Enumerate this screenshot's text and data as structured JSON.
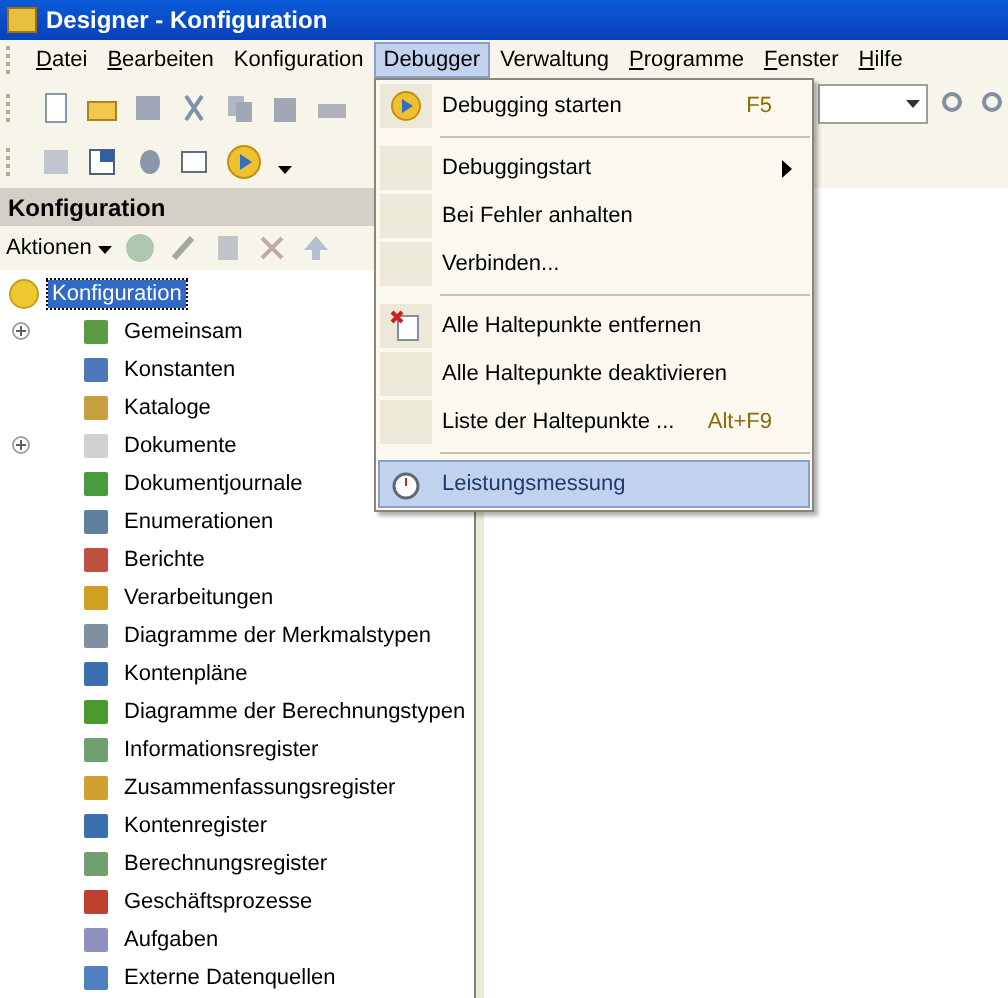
{
  "window": {
    "title": "Designer - Konfiguration"
  },
  "menu_bar": [
    {
      "label": "Datei",
      "mnemonic": true,
      "selected": false
    },
    {
      "label": "Bearbeiten",
      "mnemonic": true,
      "selected": false
    },
    {
      "label": "Konfiguration",
      "mnemonic": false,
      "selected": false
    },
    {
      "label": "Debugger",
      "mnemonic": false,
      "selected": true
    },
    {
      "label": "Verwaltung",
      "mnemonic": false,
      "selected": false
    },
    {
      "label": "Programme",
      "mnemonic": true,
      "selected": false
    },
    {
      "label": "Fenster",
      "mnemonic": true,
      "selected": false
    },
    {
      "label": "Hilfe",
      "mnemonic": true,
      "selected": false
    }
  ],
  "debugger_menu": [
    {
      "kind": "item",
      "label": "Debugging starten",
      "shortcut": "F5",
      "submenu": false,
      "selected": false
    },
    {
      "kind": "separator"
    },
    {
      "kind": "item",
      "label": "Debuggingstart",
      "submenu": true,
      "selected": false
    },
    {
      "kind": "item",
      "label": "Bei Fehler anhalten",
      "submenu": false,
      "selected": false
    },
    {
      "kind": "item",
      "label": "Verbinden...",
      "submenu": false,
      "selected": false
    },
    {
      "kind": "separator"
    },
    {
      "kind": "item",
      "label": "Alle Haltepunkte entfernen",
      "submenu": false,
      "selected": false
    },
    {
      "kind": "item",
      "label": "Alle Haltepunkte deaktivieren",
      "submenu": false,
      "selected": false
    },
    {
      "kind": "item",
      "label": "Liste der Haltepunkte ...",
      "shortcut": "Alt+F9",
      "submenu": false,
      "selected": false
    },
    {
      "kind": "separator"
    },
    {
      "kind": "item",
      "label": "Leistungsmessung",
      "submenu": false,
      "selected": true
    }
  ],
  "panel": {
    "title": "Konfiguration",
    "actions": "Aktionen"
  },
  "tree": {
    "root": {
      "label": "Konfiguration",
      "selected": true
    },
    "items": [
      {
        "label": "Gemeinsam",
        "expandable": true
      },
      {
        "label": "Konstanten",
        "expandable": false
      },
      {
        "label": "Kataloge",
        "expandable": false
      },
      {
        "label": "Dokumente",
        "expandable": true
      },
      {
        "label": "Dokumentjournale",
        "expandable": false
      },
      {
        "label": "Enumerationen",
        "expandable": false
      },
      {
        "label": "Berichte",
        "expandable": false
      },
      {
        "label": "Verarbeitungen",
        "expandable": false
      },
      {
        "label": "Diagramme der Merkmalstypen",
        "expandable": false
      },
      {
        "label": "Kontenpläne",
        "expandable": false
      },
      {
        "label": "Diagramme der Berechnungstypen",
        "expandable": false
      },
      {
        "label": "Informationsregister",
        "expandable": false
      },
      {
        "label": "Zusammenfassungsregister",
        "expandable": false
      },
      {
        "label": "Kontenregister",
        "expandable": false
      },
      {
        "label": "Berechnungsregister",
        "expandable": false
      },
      {
        "label": "Geschäftsprozesse",
        "expandable": false
      },
      {
        "label": "Aufgaben",
        "expandable": false
      },
      {
        "label": "Externe Datenquellen",
        "expandable": false
      }
    ]
  }
}
